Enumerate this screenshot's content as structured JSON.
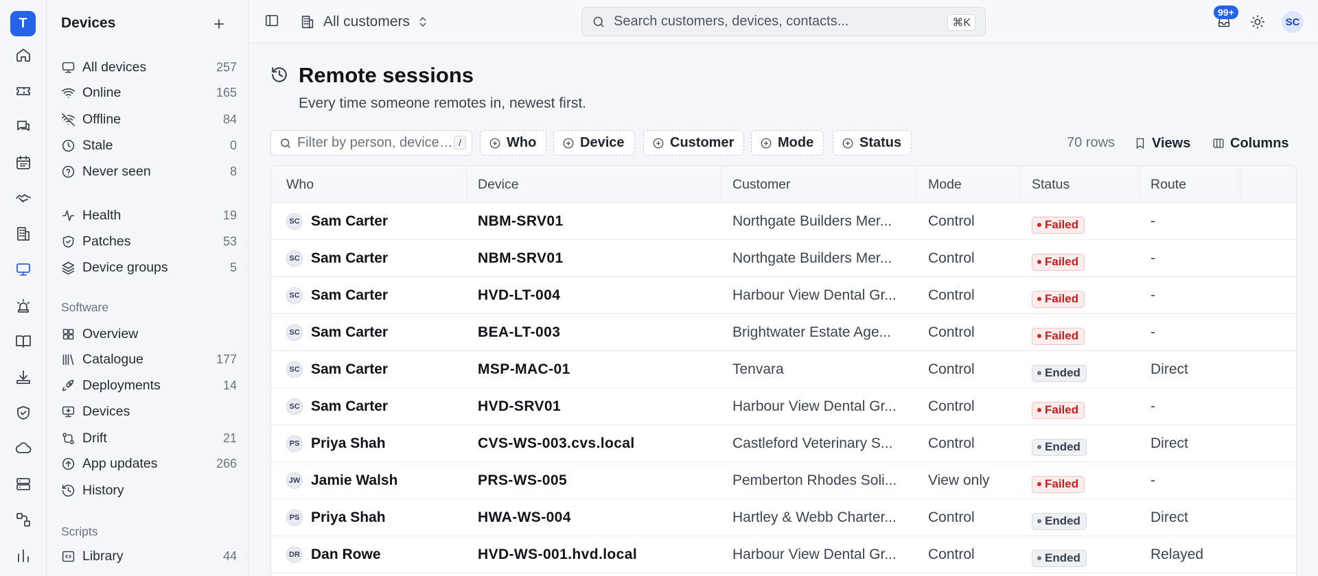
{
  "app": {
    "logo_letter": "T"
  },
  "rail": {
    "items": [
      {
        "icon": "home-icon",
        "active": false
      },
      {
        "icon": "ticket-icon",
        "active": false
      },
      {
        "icon": "messages-icon",
        "active": false
      },
      {
        "icon": "calendar-icon",
        "active": false
      },
      {
        "icon": "handshake-icon",
        "active": false
      },
      {
        "icon": "building-icon",
        "active": false
      },
      {
        "icon": "monitor-icon",
        "active": true
      },
      {
        "icon": "siren-icon",
        "active": false
      },
      {
        "icon": "book-icon",
        "active": false
      },
      {
        "icon": "download-icon",
        "active": false
      },
      {
        "icon": "shield-check-icon",
        "active": false
      },
      {
        "icon": "cloud-icon",
        "active": false
      },
      {
        "icon": "server-icon",
        "active": false
      },
      {
        "icon": "workflow-icon",
        "active": false
      },
      {
        "icon": "bar-chart-icon",
        "active": false
      }
    ]
  },
  "sidebar": {
    "title": "Devices",
    "groups": [
      {
        "label": "All devices",
        "count": "257",
        "icon": "monitor-icon"
      },
      {
        "label": "Online",
        "count": "165",
        "icon": "wifi-icon"
      },
      {
        "label": "Offline",
        "count": "84",
        "icon": "wifi-off-icon"
      },
      {
        "label": "Stale",
        "count": "0",
        "icon": "clock-icon"
      },
      {
        "label": "Never seen",
        "count": "8",
        "icon": "help-circle-icon"
      },
      {
        "label": "Health",
        "count": "19",
        "icon": "activity-icon"
      },
      {
        "label": "Patches",
        "count": "53",
        "icon": "shield-icon"
      },
      {
        "label": "Device groups",
        "count": "5",
        "icon": "layers-icon"
      }
    ],
    "software_label": "Software",
    "software": [
      {
        "label": "Overview",
        "count": "",
        "icon": "grid-icon"
      },
      {
        "label": "Catalogue",
        "count": "177",
        "icon": "library-icon"
      },
      {
        "label": "Deployments",
        "count": "14",
        "icon": "rocket-icon"
      },
      {
        "label": "Devices",
        "count": "",
        "icon": "monitor-down-icon"
      },
      {
        "label": "Drift",
        "count": "21",
        "icon": "git-compare-icon"
      },
      {
        "label": "App updates",
        "count": "266",
        "icon": "arrow-up-circle-icon"
      },
      {
        "label": "History",
        "count": "",
        "icon": "history-icon"
      }
    ],
    "scripts_label": "Scripts",
    "scripts": [
      {
        "label": "Library",
        "count": "44",
        "icon": "code-square-icon"
      }
    ]
  },
  "topbar": {
    "customer_switch": "All customers",
    "search_placeholder": "Search customers, devices, contacts...",
    "search_shortcut": "⌘K",
    "notif_badge": "99+",
    "avatar": "SC"
  },
  "page": {
    "title": "Remote sessions",
    "subtitle": "Every time someone remotes in, newest first.",
    "filter_placeholder": "Filter by person, device…",
    "filter_shortcut": "/",
    "chips": [
      "Who",
      "Device",
      "Customer",
      "Mode",
      "Status"
    ],
    "rows_count": "70 rows",
    "views_label": "Views",
    "columns_label": "Columns"
  },
  "table": {
    "columns": [
      "Who",
      "Device",
      "Customer",
      "Mode",
      "Status",
      "Route"
    ],
    "rows": [
      {
        "initials": "SC",
        "who": "Sam Carter",
        "device": "NBM-SRV01",
        "customer": "Northgate Builders Mer...",
        "mode": "Control",
        "status": "Failed",
        "route": "-"
      },
      {
        "initials": "SC",
        "who": "Sam Carter",
        "device": "NBM-SRV01",
        "customer": "Northgate Builders Mer...",
        "mode": "Control",
        "status": "Failed",
        "route": "-"
      },
      {
        "initials": "SC",
        "who": "Sam Carter",
        "device": "HVD-LT-004",
        "customer": "Harbour View Dental Gr...",
        "mode": "Control",
        "status": "Failed",
        "route": "-"
      },
      {
        "initials": "SC",
        "who": "Sam Carter",
        "device": "BEA-LT-003",
        "customer": "Brightwater Estate Age...",
        "mode": "Control",
        "status": "Failed",
        "route": "-"
      },
      {
        "initials": "SC",
        "who": "Sam Carter",
        "device": "MSP-MAC-01",
        "customer": "Tenvara",
        "mode": "Control",
        "status": "Ended",
        "route": "Direct"
      },
      {
        "initials": "SC",
        "who": "Sam Carter",
        "device": "HVD-SRV01",
        "customer": "Harbour View Dental Gr...",
        "mode": "Control",
        "status": "Failed",
        "route": "-"
      },
      {
        "initials": "PS",
        "who": "Priya Shah",
        "device": "CVS-WS-003.cvs.local",
        "customer": "Castleford Veterinary S...",
        "mode": "Control",
        "status": "Ended",
        "route": "Direct"
      },
      {
        "initials": "JW",
        "who": "Jamie Walsh",
        "device": "PRS-WS-005",
        "customer": "Pemberton Rhodes Soli...",
        "mode": "View only",
        "status": "Failed",
        "route": "-"
      },
      {
        "initials": "PS",
        "who": "Priya Shah",
        "device": "HWA-WS-004",
        "customer": "Hartley & Webb Charter...",
        "mode": "Control",
        "status": "Ended",
        "route": "Direct"
      },
      {
        "initials": "DR",
        "who": "Dan Rowe",
        "device": "HVD-WS-001.hvd.local",
        "customer": "Harbour View Dental Gr...",
        "mode": "Control",
        "status": "Ended",
        "route": "Relayed"
      }
    ]
  },
  "colors": {
    "accent": "#2563eb",
    "failed": "#c81e1e",
    "ended": "#374151"
  }
}
